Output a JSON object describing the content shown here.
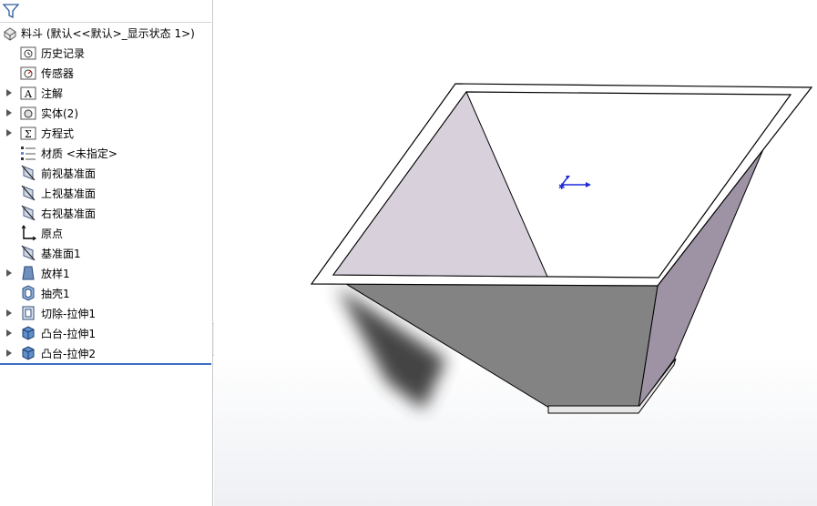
{
  "feature_tree": {
    "filter_icon": "filter-funnel-icon",
    "root": {
      "label": "料斗  (默认<<默认>_显示状态 1>)",
      "icon": "part-icon"
    },
    "items": [
      {
        "label": "历史记录",
        "icon": "history-folder-icon",
        "expandable": false
      },
      {
        "label": "传感器",
        "icon": "sensor-folder-icon",
        "expandable": false
      },
      {
        "label": "注解",
        "icon": "annotation-folder-icon",
        "expandable": true
      },
      {
        "label": "实体(2)",
        "icon": "solid-bodies-folder-icon",
        "expandable": true
      },
      {
        "label": "方程式",
        "icon": "equations-folder-icon",
        "expandable": true
      },
      {
        "label": "材质 <未指定>",
        "icon": "material-icon",
        "expandable": false
      },
      {
        "label": "前视基准面",
        "icon": "plane-icon",
        "expandable": false
      },
      {
        "label": "上视基准面",
        "icon": "plane-icon",
        "expandable": false
      },
      {
        "label": "右视基准面",
        "icon": "plane-icon",
        "expandable": false
      },
      {
        "label": "原点",
        "icon": "origin-icon",
        "expandable": false
      },
      {
        "label": "基准面1",
        "icon": "plane-icon",
        "expandable": false
      },
      {
        "label": "放样1",
        "icon": "loft-feature-icon",
        "expandable": true
      },
      {
        "label": "抽壳1",
        "icon": "shell-feature-icon",
        "expandable": false
      },
      {
        "label": "切除-拉伸1",
        "icon": "cut-extrude-icon",
        "expandable": true
      },
      {
        "label": "凸台-拉伸1",
        "icon": "boss-extrude-icon",
        "expandable": true
      },
      {
        "label": "凸台-拉伸2",
        "icon": "boss-extrude-icon",
        "expandable": true
      }
    ]
  },
  "viewport": {
    "model": "hopper-3d-model",
    "triad": "origin-triad-icon",
    "colors": {
      "rim_face": "#ffffff",
      "inner_left_wall": "#d8d1dc",
      "outer_front_wall": "#838383",
      "outer_right_wall": "#9e93a4",
      "shadow": "#3a3a3a",
      "edge": "#000000",
      "triad_blue": "#1a2ad8"
    }
  }
}
